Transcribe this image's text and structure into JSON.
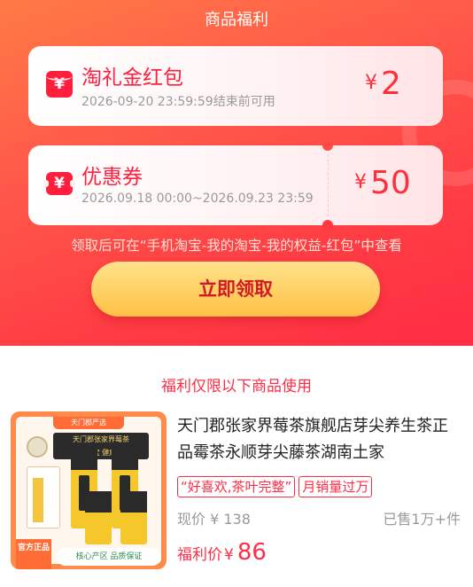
{
  "header": {
    "title": "商品福利"
  },
  "cards": [
    {
      "icon": "red-envelope-icon",
      "icon_glyph": "¥",
      "title": "淘礼金红包",
      "subtitle": "2026-09-20 23:59:59结束前可用",
      "currency": "¥",
      "amount": "2"
    },
    {
      "icon": "coupon-ticket-icon",
      "icon_glyph": "¥",
      "title": "优惠券",
      "subtitle": "2026.09.18 00:00~2026.09.23 23:59",
      "currency": "¥",
      "amount": "50"
    }
  ],
  "tip": "领取后可在“手机淘宝-我的淘宝-我的权益-红包”中查看",
  "claim_button": "立即领取",
  "section_title": "福利仅限以下商品使用",
  "product": {
    "image_top_tag": "天门郡严选",
    "image_headline_1": "天门郡张家界莓茶",
    "image_headline_2": "民族瑰宝 健康好茶",
    "image_badge_left": "官方正品",
    "image_badge_right": "核心产区 品质保证",
    "title": "天门郡张家界莓茶旗舰店芽尖养生茶正品霉茶永顺芽尖藤茶湖南土家",
    "tags": [
      "“好喜欢,茶叶完整”",
      "月销量过万"
    ],
    "price_now_label": "现价 ¥ 138",
    "sold": "已售1万+件",
    "fuli_label": "福利价",
    "fuli_currency": "¥",
    "fuli_price": "86"
  },
  "colors": {
    "accent_red": "#ff2d47",
    "button_gold": "#ffc045",
    "banner_orange": "#ff7a45"
  }
}
